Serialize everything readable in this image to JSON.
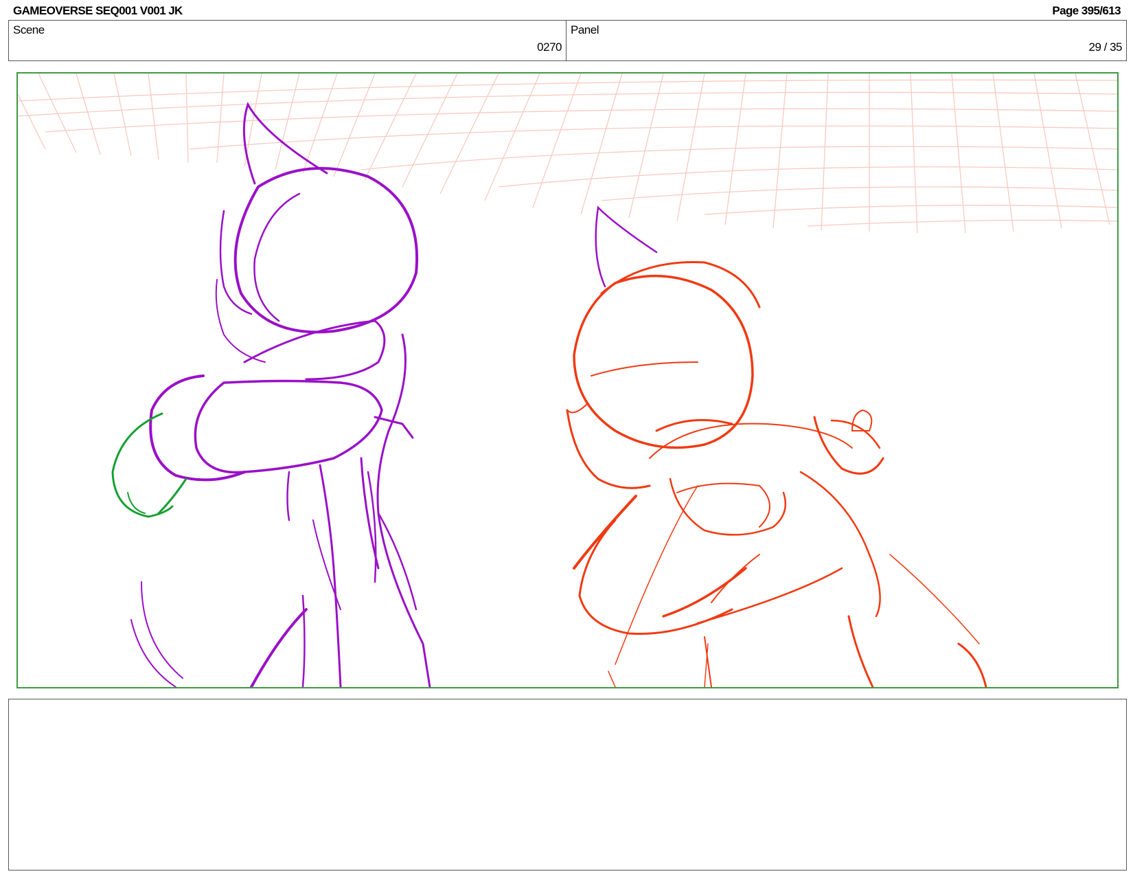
{
  "header": {
    "title": "GAMEOVERSE SEQ001 V001 JK",
    "page": "Page 395/613"
  },
  "scene": {
    "label": "Scene",
    "value": "0270"
  },
  "panel": {
    "label": "Panel",
    "value": "29 / 35"
  },
  "frame": {
    "colors": {
      "border": "#3f9a3f",
      "grid": "#f6b9ad",
      "character_left": "#9a10c8",
      "character_right": "#f03a12",
      "accent": "#16a030"
    }
  },
  "notes": {
    "text": ""
  }
}
